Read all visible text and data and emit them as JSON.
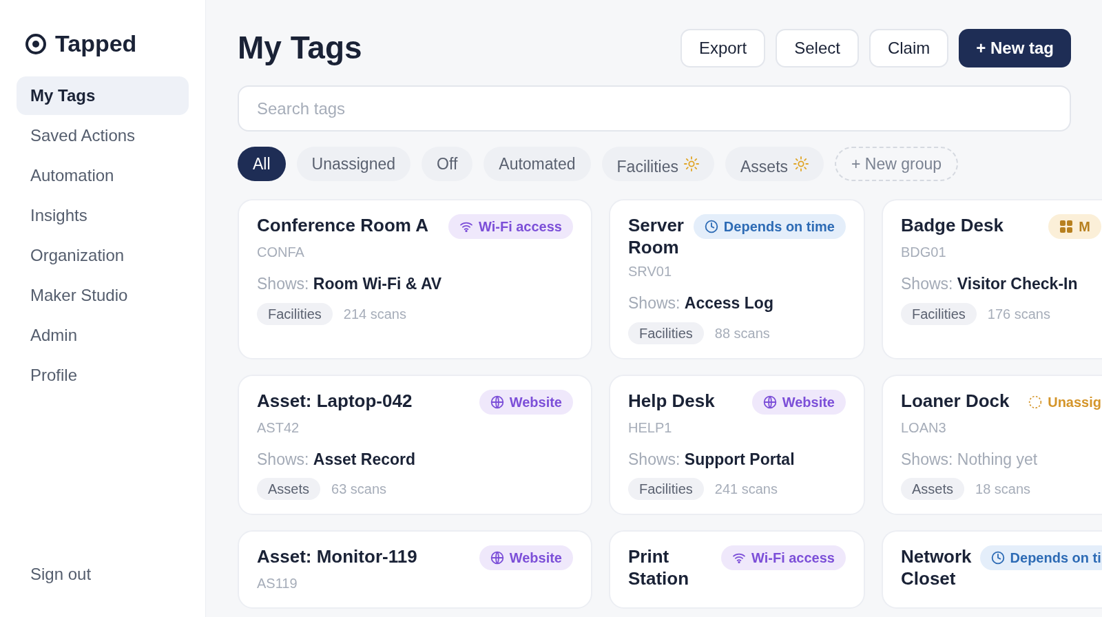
{
  "sidebar": {
    "brand": "Tapped",
    "items": [
      {
        "label": "My Tags",
        "selected": true
      },
      {
        "label": "Saved Actions",
        "selected": false
      },
      {
        "label": "Automation",
        "selected": false
      },
      {
        "label": "Insights",
        "selected": false
      },
      {
        "label": "Organization",
        "selected": false
      },
      {
        "label": "Maker Studio",
        "selected": false
      },
      {
        "label": "Admin",
        "selected": false
      },
      {
        "label": "Profile",
        "selected": false
      }
    ],
    "sign_out": "Sign out"
  },
  "header": {
    "title": "My Tags",
    "buttons": [
      {
        "label": "Export",
        "kind": "outline"
      },
      {
        "label": "Select",
        "kind": "outline"
      },
      {
        "label": "Claim",
        "kind": "outline"
      },
      {
        "label": "+ New tag",
        "kind": "primary"
      }
    ]
  },
  "search": {
    "placeholder": "Search tags"
  },
  "filters": [
    {
      "label": "All",
      "kind": "plain",
      "selected": true
    },
    {
      "label": "Unassigned",
      "kind": "plain",
      "selected": false
    },
    {
      "label": "Off",
      "kind": "plain",
      "selected": false
    },
    {
      "label": "Automated",
      "kind": "plain",
      "selected": false
    },
    {
      "label": "Facilities",
      "kind": "auto",
      "selected": false
    },
    {
      "label": "Assets",
      "kind": "auto",
      "selected": false
    },
    {
      "label": "+ New group",
      "kind": "add",
      "selected": false
    }
  ],
  "tag_rows": [
    [
      {
        "name": "Conference Room A",
        "code": "CONFA",
        "badge": {
          "kind": "wifi",
          "label": "Wi-Fi access"
        },
        "shows_label": "Shows:",
        "shows": "Room Wi-Fi & AV",
        "shows_empty": false,
        "group": "Facilities",
        "scans": "214 scans"
      },
      {
        "name": "Server Room",
        "code": "SRV01",
        "badge": {
          "kind": "time",
          "label": "Depends on time"
        },
        "shows_label": "Shows:",
        "shows": "Access Log",
        "shows_empty": false,
        "group": "Facilities",
        "scans": "88 scans"
      },
      {
        "name": "Badge Desk",
        "code": "BDG01",
        "badge": {
          "kind": "grid",
          "label": "M"
        },
        "shows_label": "Shows:",
        "shows": "Visitor Check-In",
        "shows_empty": false,
        "group": "Facilities",
        "scans": "176 scans"
      }
    ],
    [
      {
        "name": "Asset: Laptop-042",
        "code": "AST42",
        "badge": {
          "kind": "website",
          "label": "Website"
        },
        "shows_label": "Shows:",
        "shows": "Asset Record",
        "shows_empty": false,
        "group": "Assets",
        "scans": "63 scans"
      },
      {
        "name": "Help Desk",
        "code": "HELP1",
        "badge": {
          "kind": "website",
          "label": "Website"
        },
        "shows_label": "Shows:",
        "shows": "Support Portal",
        "shows_empty": false,
        "group": "Facilities",
        "scans": "241 scans"
      },
      {
        "name": "Loaner Dock",
        "code": "LOAN3",
        "badge": {
          "kind": "unassigned",
          "label": "Unassig"
        },
        "shows_label": "Shows:",
        "shows": "Nothing yet",
        "shows_empty": true,
        "group": "Assets",
        "scans": "18 scans"
      }
    ],
    [
      {
        "name": "Asset: Monitor-119",
        "code": "AS119",
        "badge": {
          "kind": "website",
          "label": "Website"
        }
      },
      {
        "name": "Print Station",
        "badge": {
          "kind": "wifi",
          "label": "Wi-Fi access"
        }
      },
      {
        "name": "Network Closet",
        "badge": {
          "kind": "time",
          "label": "Depends on ti"
        }
      }
    ]
  ]
}
